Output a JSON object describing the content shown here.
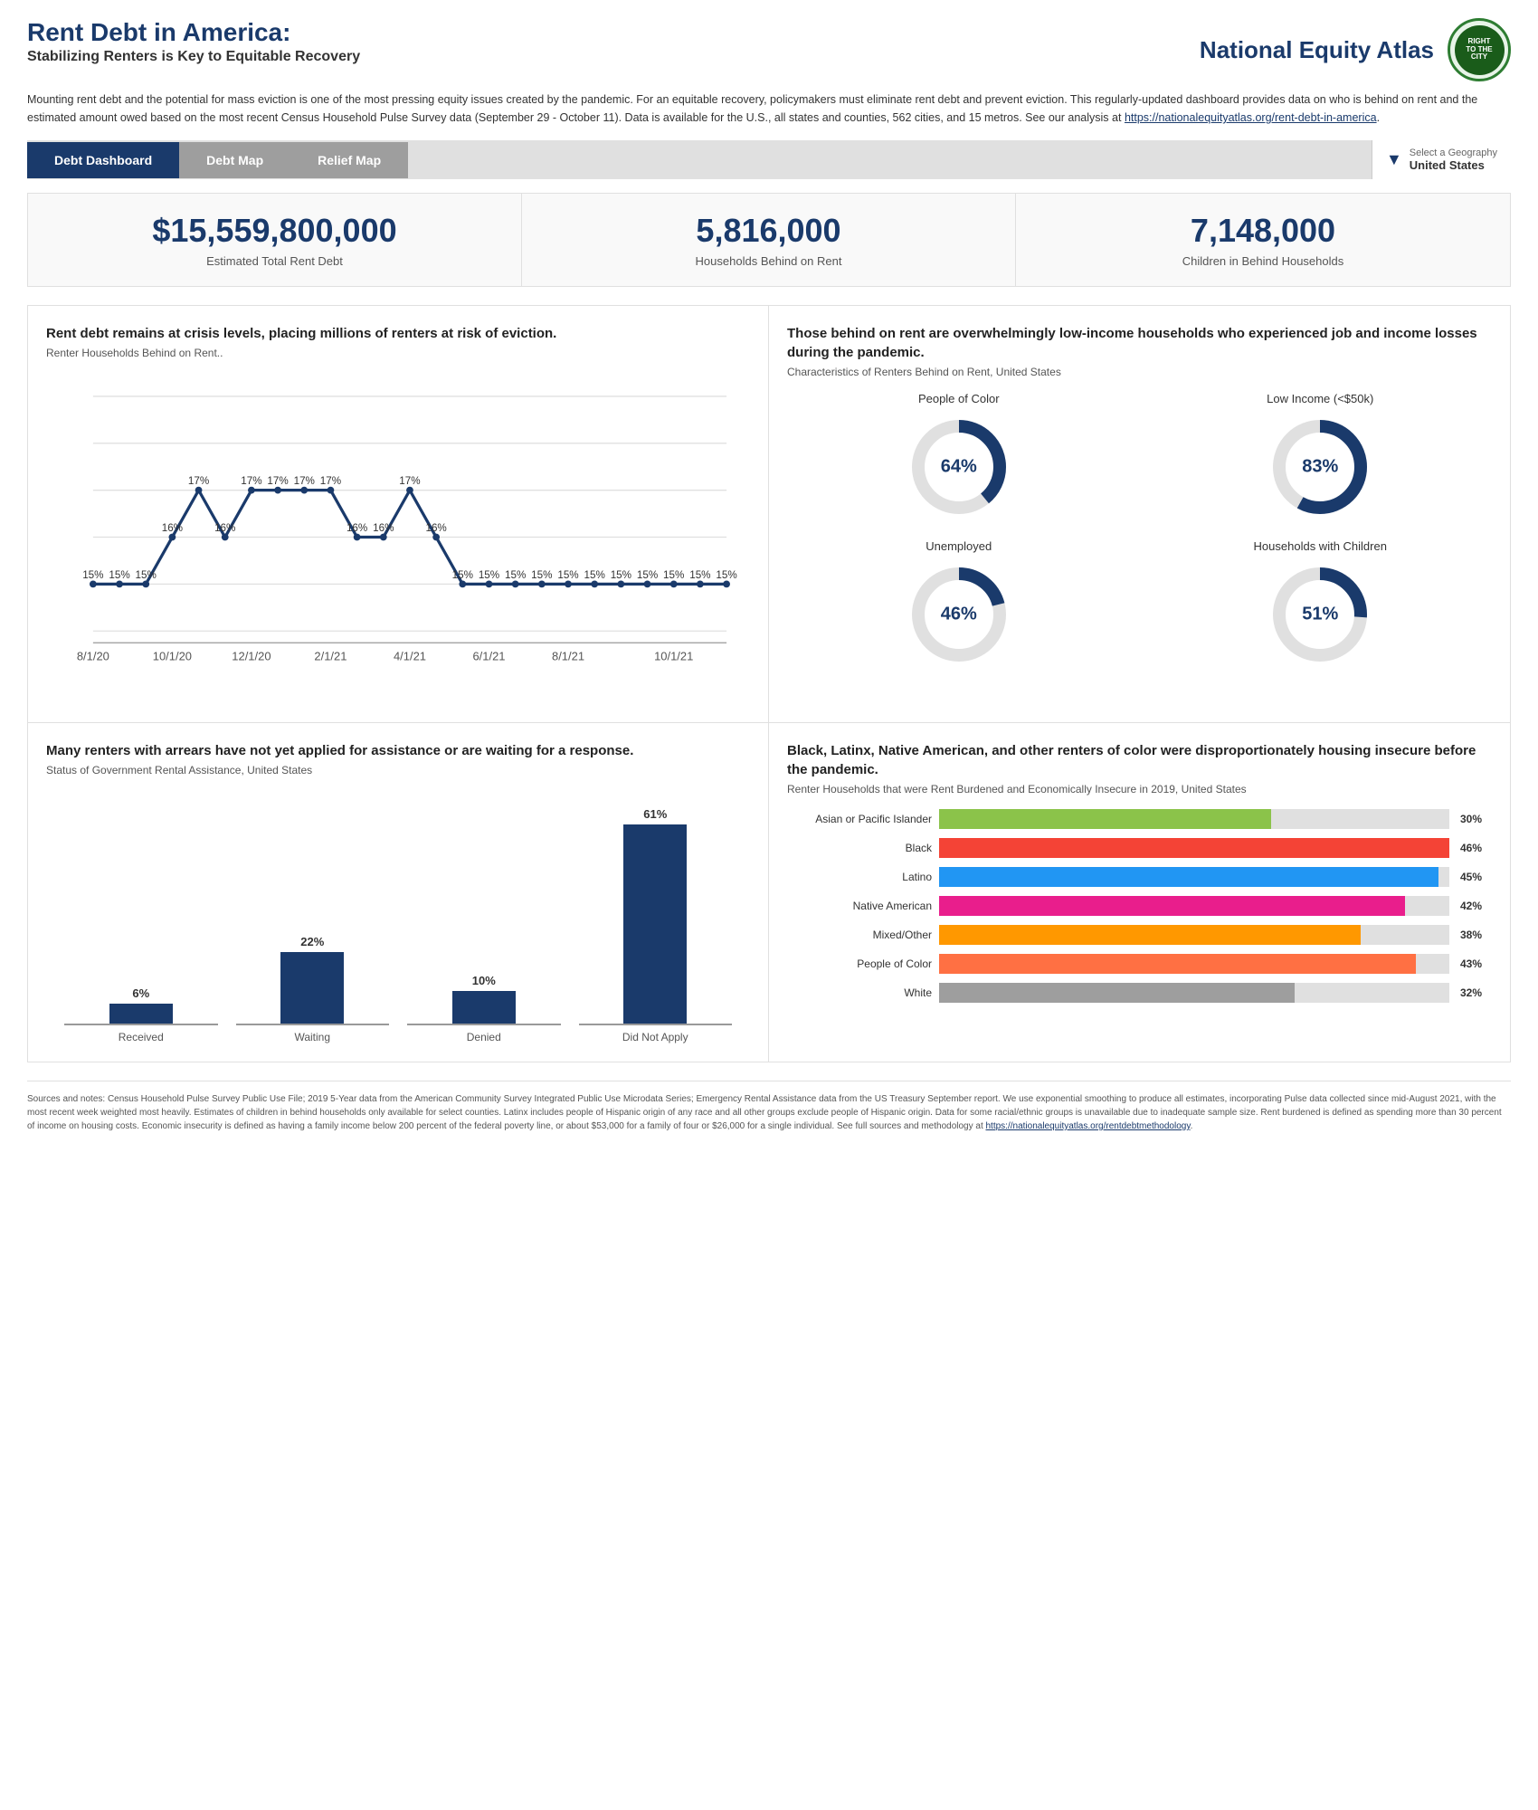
{
  "header": {
    "title": "Rent Debt in America:",
    "subtitle": "Stabilizing Renters is Key to Equitable Recovery",
    "logo_text": "National Equity Atlas",
    "logo_inner": "RIGHT\nTO\nTHE\nCITY"
  },
  "intro": {
    "text": "Mounting rent debt and the potential for mass eviction is one of the most pressing equity issues created by the pandemic. For an equitable recovery, policymakers must eliminate rent debt and prevent eviction. This regularly-updated dashboard provides data on who is behind on rent and the estimated amount owed based on the most recent Census Household Pulse Survey data (September 29 - October 11). Data is available for the U.S., all states and counties, 562 cities, and 15 metros. See our analysis at ",
    "link_text": "https://nationalequityatlas.org/rent-debt-in-america",
    "link_href": "https://nationalequityatlas.org/rent-debt-in-america"
  },
  "nav": {
    "tabs": [
      {
        "label": "Debt Dashboard",
        "active": true
      },
      {
        "label": "Debt Map",
        "active": false
      },
      {
        "label": "Relief Map",
        "active": false
      }
    ],
    "geo_label": "Select a Geography",
    "geo_value": "United States"
  },
  "kpis": [
    {
      "value": "$15,559,800,000",
      "label": "Estimated Total Rent Debt"
    },
    {
      "value": "5,816,000",
      "label": "Households Behind on Rent"
    },
    {
      "value": "7,148,000",
      "label": "Children in Behind Households"
    }
  ],
  "panel1": {
    "title": "Rent debt remains at crisis levels, placing millions of renters at risk of eviction.",
    "subtitle": "Renter Households Behind on Rent..",
    "chart_points": [
      {
        "x": 0,
        "y": 15,
        "label": "15%"
      },
      {
        "x": 1,
        "y": 15,
        "label": "15%"
      },
      {
        "x": 2,
        "y": 15,
        "label": "15%"
      },
      {
        "x": 3,
        "y": 16,
        "label": "16%"
      },
      {
        "x": 4,
        "y": 17,
        "label": "17%"
      },
      {
        "x": 5,
        "y": 16,
        "label": "16%"
      },
      {
        "x": 6,
        "y": 17,
        "label": "17%"
      },
      {
        "x": 7,
        "y": 17,
        "label": "17%"
      },
      {
        "x": 8,
        "y": 17,
        "label": "17%"
      },
      {
        "x": 9,
        "y": 17,
        "label": "17%"
      },
      {
        "x": 10,
        "y": 16,
        "label": "16%"
      },
      {
        "x": 11,
        "y": 16,
        "label": "16%"
      },
      {
        "x": 12,
        "y": 17,
        "label": "17%"
      },
      {
        "x": 13,
        "y": 16,
        "label": "16%"
      },
      {
        "x": 14,
        "y": 15,
        "label": "15%"
      },
      {
        "x": 15,
        "y": 15,
        "label": "15%"
      },
      {
        "x": 16,
        "y": 15,
        "label": "15%"
      },
      {
        "x": 17,
        "y": 15,
        "label": "15%"
      },
      {
        "x": 18,
        "y": 15,
        "label": "15%"
      },
      {
        "x": 19,
        "y": 15,
        "label": "15%"
      },
      {
        "x": 20,
        "y": 15,
        "label": "15%"
      },
      {
        "x": 21,
        "y": 15,
        "label": "15%"
      },
      {
        "x": 22,
        "y": 15,
        "label": "15%"
      },
      {
        "x": 23,
        "y": 15,
        "label": "15%"
      },
      {
        "x": 24,
        "y": 15,
        "label": "15%"
      }
    ],
    "x_labels": [
      "8/1/20",
      "10/1/20",
      "12/1/20",
      "2/1/21",
      "4/1/21",
      "6/1/21",
      "8/1/21",
      "10/1/21"
    ]
  },
  "panel2": {
    "title": "Those behind on rent are overwhelmingly low-income households who experienced job and income losses during the pandemic.",
    "subtitle": "Characteristics of Renters Behind on Rent, United States",
    "donuts": [
      {
        "label": "People of Color",
        "pct": 64,
        "color": "#1a3a6b"
      },
      {
        "label": "Low Income (<$50k)",
        "pct": 83,
        "color": "#1a3a6b"
      },
      {
        "label": "Unemployed",
        "pct": 46,
        "color": "#1a3a6b"
      },
      {
        "label": "Households with Children",
        "pct": 51,
        "color": "#1a3a6b"
      }
    ]
  },
  "panel3": {
    "title": "Many renters with arrears have not yet applied for assistance or are waiting for a response.",
    "subtitle": "Status of Government Rental Assistance, United States",
    "bars": [
      {
        "label": "Received",
        "value": 6,
        "display": "6%"
      },
      {
        "label": "Waiting",
        "value": 22,
        "display": "22%"
      },
      {
        "label": "Denied",
        "value": 10,
        "display": "10%"
      },
      {
        "label": "Did Not Apply",
        "value": 61,
        "display": "61%"
      }
    ]
  },
  "panel4": {
    "title": "Black, Latinx, Native American, and other renters of color were disproportionately housing insecure before the pandemic.",
    "subtitle": "Renter Households that were Rent Burdened and Economically Insecure in 2019, United States",
    "hbars": [
      {
        "label": "Asian or Pacific Islander",
        "pct": 30,
        "display": "30%",
        "color": "#8bc34a"
      },
      {
        "label": "Black",
        "pct": 46,
        "display": "46%",
        "color": "#f44336"
      },
      {
        "label": "Latino",
        "pct": 45,
        "display": "45%",
        "color": "#2196f3"
      },
      {
        "label": "Native American",
        "pct": 42,
        "display": "42%",
        "color": "#e91e8c"
      },
      {
        "label": "Mixed/Other",
        "pct": 38,
        "display": "38%",
        "color": "#ff9800"
      },
      {
        "label": "People of Color",
        "pct": 43,
        "display": "43%",
        "color": "#ff7043"
      },
      {
        "label": "White",
        "pct": 32,
        "display": "32%",
        "color": "#9e9e9e"
      }
    ]
  },
  "footer": {
    "text": "Sources and notes: Census Household Pulse Survey Public Use File; 2019 5-Year data from the American Community Survey Integrated Public Use Microdata Series; Emergency Rental Assistance data from the US Treasury September report. We use exponential smoothing to produce all estimates, incorporating Pulse data collected since mid-August 2021, with the most recent week weighted most heavily. Estimates of children in behind households only available for select counties. Latinx includes people of Hispanic origin of any race and all other groups exclude people of Hispanic origin. Data for some racial/ethnic groups is unavailable due to inadequate sample size. Rent burdened is defined as spending more than 30 percent of income on housing costs. Economic insecurity is defined as having a family income below 200 percent of the federal poverty line, or about $53,000 for a family of four or $26,000 for a single individual. See full sources and methodology at ",
    "link_text": "https://nationalequityatlas.org/rentdebtmethodology",
    "link_href": "https://nationalequityatlas.org/rentdebtmethodology"
  }
}
